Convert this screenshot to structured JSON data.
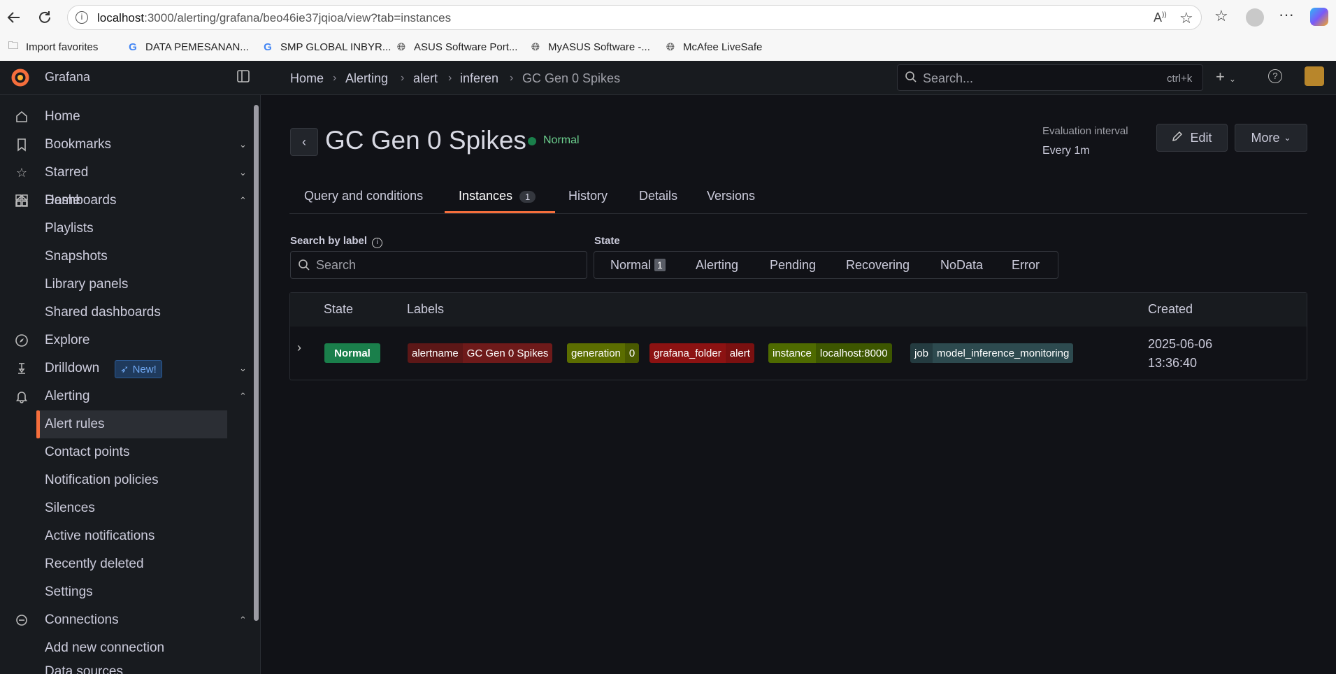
{
  "browser": {
    "url_host": "localhost",
    "url_rest": ":3000/alerting/grafana/beo46ie37jqioa/view?tab=instances",
    "bookmarks": [
      {
        "label": "Import favorites"
      },
      {
        "label": "DATA PEMESANAN..."
      },
      {
        "label": "SMP GLOBAL INBYR..."
      },
      {
        "label": "ASUS Software Port..."
      },
      {
        "label": "MyASUS Software -..."
      },
      {
        "label": "McAfee LiveSafe"
      }
    ]
  },
  "app": {
    "name": "Grafana",
    "search_placeholder": "Search...",
    "search_shortcut": "ctrl+k",
    "accent": "#f56e3c"
  },
  "breadcrumb": [
    "Home",
    "Alerting",
    "alert",
    "inferen",
    "GC Gen 0 Spikes"
  ],
  "sidebar": {
    "items": [
      {
        "label": "Home"
      },
      {
        "label": "Bookmarks"
      },
      {
        "label": "Starred"
      },
      {
        "label": "Dashboards"
      },
      {
        "label": "Playlists"
      },
      {
        "label": "Snapshots"
      },
      {
        "label": "Library panels"
      },
      {
        "label": "Shared dashboards"
      },
      {
        "label": "Explore"
      },
      {
        "label": "Drilldown",
        "badge": "New!"
      },
      {
        "label": "Alerting"
      },
      {
        "label": "Alert rules"
      },
      {
        "label": "Contact points"
      },
      {
        "label": "Notification policies"
      },
      {
        "label": "Silences"
      },
      {
        "label": "Active notifications"
      },
      {
        "label": "Recently deleted"
      },
      {
        "label": "Settings"
      },
      {
        "label": "Connections"
      },
      {
        "label": "Add new connection"
      },
      {
        "label": "Data sources"
      }
    ]
  },
  "rule": {
    "title": "GC Gen 0 Spikes",
    "status": "Normal",
    "eval_label": "Evaluation interval",
    "eval_value": "Every 1m",
    "edit_label": "Edit",
    "more_label": "More"
  },
  "tabs": [
    {
      "label": "Query and conditions"
    },
    {
      "label": "Instances",
      "count": "1"
    },
    {
      "label": "History"
    },
    {
      "label": "Details"
    },
    {
      "label": "Versions"
    }
  ],
  "filters": {
    "search_label": "Search by label",
    "search_placeholder": "Search",
    "state_label": "State",
    "states": [
      {
        "label": "Normal",
        "count": "1"
      },
      {
        "label": "Alerting"
      },
      {
        "label": "Pending"
      },
      {
        "label": "Recovering"
      },
      {
        "label": "NoData"
      },
      {
        "label": "Error"
      }
    ]
  },
  "table": {
    "headers": {
      "state": "State",
      "labels": "Labels",
      "created": "Created"
    },
    "rows": [
      {
        "state": "Normal",
        "created_date": "2025-06-06",
        "created_time": "13:36:40",
        "labels": [
          {
            "key": "alertname",
            "value": "GC Gen 0 Spikes"
          },
          {
            "key": "generation",
            "value": "0"
          },
          {
            "key": "grafana_folder",
            "value": "alert"
          },
          {
            "key": "instance",
            "value": "localhost:8000"
          },
          {
            "key": "job",
            "value": "model_inference_monitoring"
          }
        ]
      }
    ]
  }
}
